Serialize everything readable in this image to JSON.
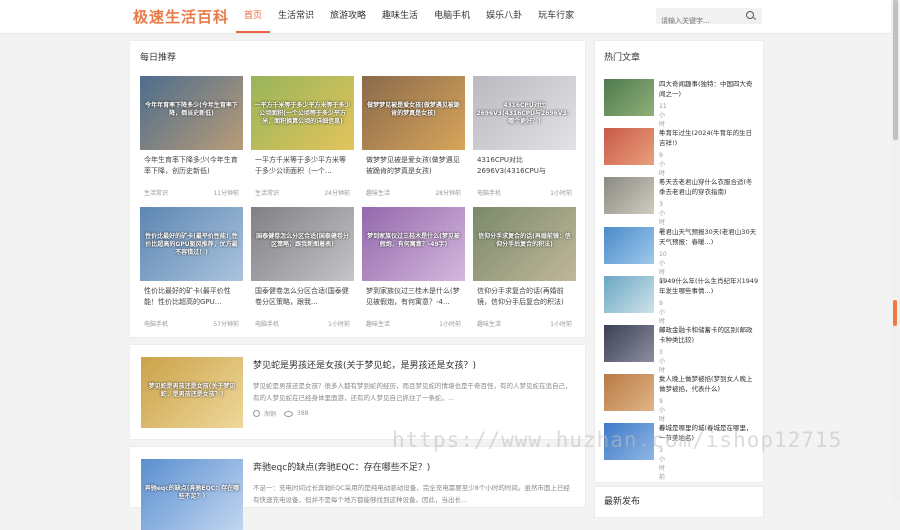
{
  "site": {
    "logo": "极速生活百科"
  },
  "nav": {
    "items": [
      "首页",
      "生活常识",
      "旅游攻略",
      "趣味生活",
      "电脑手机",
      "娱乐八卦",
      "玩车行家"
    ]
  },
  "search": {
    "placeholder": "请输入关键字..."
  },
  "daily": {
    "title": "每日推荐",
    "items": [
      {
        "overlay": "今年年育率下降多少(今年生育率下降，倒当史新低)",
        "title": "今年生育率下降多少(今年生育率下降，创历史新低)",
        "category": "生活常识",
        "time": "11分钟前",
        "colors": [
          "#4d6d8e",
          "#b99c78"
        ]
      },
      {
        "overlay": "一平方千米等于多少平方米等于多少公顷面积(一个公顷等于多少平方米，面积换算公顷的详细信息)",
        "title": "一平方千米等于多少平方米等于多少公顷面积（一个...",
        "category": "生活常识",
        "time": "24分钟前",
        "colors": [
          "#97b55a",
          "#e4c45c"
        ]
      },
      {
        "overlay": "做梦梦见被是爱女孩(做梦遇见被跪肯的梦真是女孩)",
        "title": "做梦梦见被是爱女孩(做梦遇见被跪肯的梦真是女孩)",
        "category": "趣味生活",
        "time": "28分钟前",
        "colors": [
          "#8a6a4c",
          "#d8a55a"
        ]
      },
      {
        "overlay": "4316CPU对比2696V3(4316CPU与2696V3：哪个更好？)",
        "title": "4316CPU对比2696V3(4316CPU与2696V3：哪个更...",
        "category": "电脑手机",
        "time": "1小时前",
        "colors": [
          "#b9b9bf",
          "#e2e2e6"
        ]
      },
      {
        "overlay": "性价比最好的矿卡(最平价性能！性价比超高的GPU驱风推荐，优方最不容错过！)",
        "title": "性价比最好的矿卡(最平价性能！性价比超高的GPU...",
        "category": "电脑手机",
        "time": "57分钟前",
        "colors": [
          "#5d86b2",
          "#aac4de"
        ]
      },
      {
        "overlay": "国泰健卷怎么分区合适(国泰健卷分区策略，跟我新图着表)",
        "title": "国泰健卷怎么分区合适(国泰健卷分区策略，跟我...",
        "category": "电脑手机",
        "time": "1小时前",
        "colors": [
          "#7f7f85",
          "#c5c5c8"
        ]
      },
      {
        "overlay": "梦到家族仪过三桂木是什么(梦见被假炮，有何寓意？-49字)",
        "title": "梦到家族仪过三桂木是什么(梦见被假炮，有何寓意？-4...",
        "category": "趣味生活",
        "time": "1小时前",
        "colors": [
          "#9468ac",
          "#d4b8de"
        ]
      },
      {
        "overlay": "信仰分手求复合的话(再婚前镜：信仰分手后复合的积法)",
        "title": "信仰分手求复合的话(再婚前镜，信仰分手后复合的积法)",
        "category": "趣味生活",
        "time": "1小时前",
        "colors": [
          "#7a8a6a",
          "#c1b79a"
        ]
      }
    ]
  },
  "posts": [
    {
      "overlay": "梦见蛇是男孩还是女孩(关于梦见蛇，是男孩还是女孩？)",
      "title": "梦见蛇是男孩还是女孩(关于梦见蛇，是男孩还是女孩？)",
      "desc": "梦见蛇是男孩还是女孩？很多人都有梦到蛇的经历，而且梦见蛇的情境也是千奇百怪，有的人梦见蛇在追自己，有的人梦见蛇在已经身体里面游，还有的人梦见自己抓住了一条蛇。...",
      "author": "淘铜",
      "views": "388",
      "colors": [
        "#caa24a",
        "#efd89a"
      ]
    },
    {
      "overlay": "奔驰eqc的缺点(奔驰EQC：存在哪些不足？)",
      "title": "奔驰eqc的缺点(奔驰EQC：存在哪些不足？)",
      "desc": "不足一：充电时间过长奔驰EQC采用的是纯电动驱动设备，完全充电需要至少8个小时的时间。虽然市面上已经有快速充电设备，但并不是每个地方都能够找到这种设备。因此，当出长...",
      "author": "",
      "views": "",
      "colors": [
        "#5a8fd0",
        "#c2d6f0"
      ]
    }
  ],
  "hot": {
    "title": "热门文章",
    "items": [
      {
        "title": "四大奇闻趣事(独特：中国四大奇闻之一)",
        "time": "11小时前",
        "colors": [
          "#4e7a4c",
          "#8fb07a"
        ]
      },
      {
        "title": "牛育年过生(2024(牛育年的生日 吉祥!)",
        "time": "9小时前",
        "colors": [
          "#c9594a",
          "#e9a07a"
        ]
      },
      {
        "title": "冬天去老君山穿什么衣服合适(冬季去老君山的穿衣指南)",
        "time": "3小时前",
        "colors": [
          "#8a8a82",
          "#d0ccc0"
        ]
      },
      {
        "title": "老君山天气预报30天(老君山30天天气预报：春暖...)",
        "time": "10小时前",
        "colors": [
          "#4c8acb",
          "#9ec9ea"
        ]
      },
      {
        "title": "1949什么年(什么生肖纪年)(1949年发生哪些事情...)",
        "time": "9小时前",
        "colors": [
          "#6aa7c4",
          "#cfe2ea"
        ]
      },
      {
        "title": "邮政金融卡和储蓄卡的区别(邮政卡种类比较)",
        "time": "3小时前",
        "colors": [
          "#3d3f55",
          "#8c8ea0"
        ]
      },
      {
        "title": "女人晚上做梦被掐(梦到女人晚上做梦被掐，代表什么)",
        "time": "9小时前",
        "colors": [
          "#b97a45",
          "#e0b586"
        ]
      },
      {
        "title": "春城是哪里的城(春城是在哪里，一节美地名)",
        "time": "3小时前",
        "colors": [
          "#3f7ac8",
          "#8fb6e4"
        ]
      }
    ]
  },
  "latest": {
    "title": "最新发布"
  },
  "watermark": "https://www.huzhan.com/ishop12715"
}
